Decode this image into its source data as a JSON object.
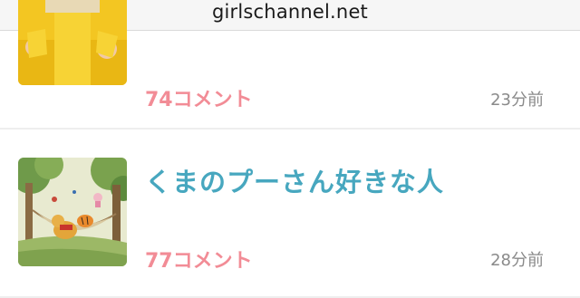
{
  "browser": {
    "url": "girlschannel.net"
  },
  "topics": [
    {
      "thumbnail": "yellow-suit-person-image",
      "comments": "74コメント",
      "time": "23分前"
    },
    {
      "thumbnail": "winnie-the-pooh-hammock-illustration",
      "title": "くまのプーさん好きな人",
      "comments": "77コメント",
      "time": "28分前"
    }
  ],
  "colors": {
    "title": "#47a7bf",
    "comments": "#f28c96",
    "time": "#8a8a8a",
    "divider": "#eeeeee"
  }
}
